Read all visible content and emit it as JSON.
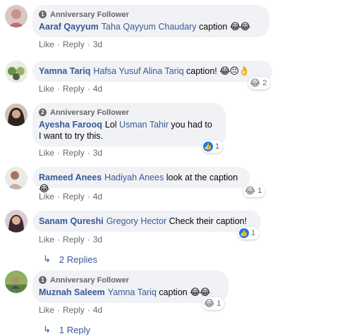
{
  "comments": [
    {
      "badge": "Anniversary Follower",
      "author": "Aaraf Qayyum",
      "mentions": "Taha Qayyum Chaudary",
      "text": " caption ",
      "emoji": "😂😂",
      "actions": {
        "like": "Like",
        "reply": "Reply",
        "time": "3d"
      }
    },
    {
      "author": "Yamna Tariq",
      "mentions": "Hafsa Yusuf Alina Tariq",
      "text": " caption! ",
      "emoji": "😂😐👌",
      "reaction": {
        "icon": "😂",
        "count": "2"
      },
      "actions": {
        "like": "Like",
        "reply": "Reply",
        "time": "4d"
      }
    },
    {
      "badge": "Anniversary Follower",
      "author": "Ayesha Farooq",
      "text_a": "Lol ",
      "mentions": "Usman Tahir",
      "text_b": " you had to",
      "line2": "I want to try this.",
      "reaction": {
        "icon": "👍",
        "count": "1"
      },
      "actions": {
        "like": "Like",
        "reply": "Reply",
        "time": "3d"
      }
    },
    {
      "author": "Rameed Anees",
      "mentions": "Hadiyah Anees",
      "text": " look at the caption ",
      "emoji": "😂",
      "reaction": {
        "icon": "😂",
        "count": "1"
      },
      "actions": {
        "like": "Like",
        "reply": "Reply",
        "time": "4d"
      }
    },
    {
      "author": "Sanam Qureshi",
      "mentions": "Gregory Hector",
      "text": " Check their caption!",
      "reaction": {
        "icon": "👍",
        "count": "1"
      },
      "actions": {
        "like": "Like",
        "reply": "Reply",
        "time": "3d"
      },
      "replies": "2 Replies"
    },
    {
      "badge": "Anniversary Follower",
      "author": "Muznah Saleem",
      "mentions": "Yamna Tariq",
      "text": " caption ",
      "emoji": "😂😂",
      "reaction": {
        "icon": "😂",
        "count": "1"
      },
      "actions": {
        "like": "Like",
        "reply": "Reply",
        "time": "4d"
      },
      "replies": "1 Reply"
    }
  ],
  "colors": {
    "name": "#385898",
    "bubble": "#f0f2f5",
    "meta": "#65676b",
    "like": "#1877f2"
  }
}
